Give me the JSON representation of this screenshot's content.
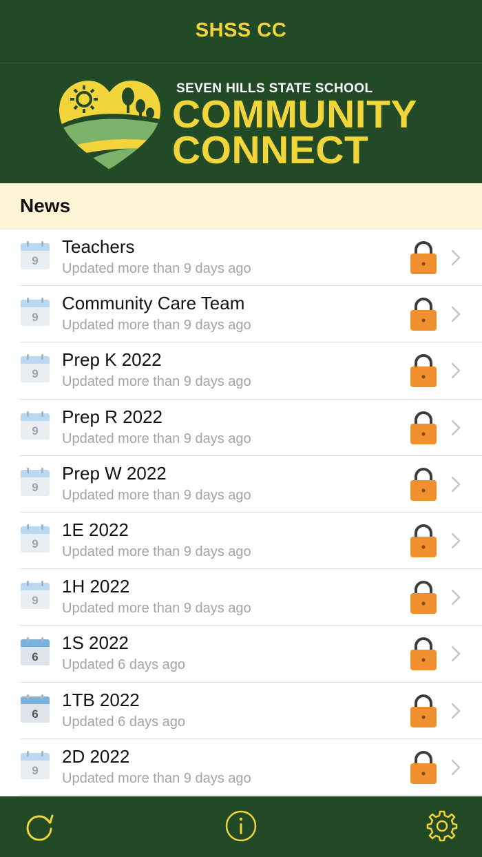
{
  "nav": {
    "title": "SHSS CC"
  },
  "banner": {
    "school_name": "SEVEN HILLS STATE SCHOOL",
    "brand_line1": "COMMUNITY",
    "brand_line2": "CONNECT"
  },
  "section": {
    "title": "News"
  },
  "items": [
    {
      "title": "Teachers",
      "subtitle": "Updated more than 9 days ago",
      "day": "9",
      "locked": true
    },
    {
      "title": "Community Care Team",
      "subtitle": "Updated more than 9 days ago",
      "day": "9",
      "locked": true
    },
    {
      "title": "Prep K 2022",
      "subtitle": "Updated more than 9 days ago",
      "day": "9",
      "locked": true
    },
    {
      "title": "Prep R 2022",
      "subtitle": "Updated more than 9 days ago",
      "day": "9",
      "locked": true
    },
    {
      "title": "Prep W 2022",
      "subtitle": "Updated more than 9 days ago",
      "day": "9",
      "locked": true
    },
    {
      "title": "1E 2022",
      "subtitle": "Updated more than 9 days ago",
      "day": "9",
      "locked": true
    },
    {
      "title": "1H 2022",
      "subtitle": "Updated more than 9 days ago",
      "day": "9",
      "locked": true
    },
    {
      "title": "1S 2022",
      "subtitle": "Updated 6 days ago",
      "day": "6",
      "locked": true
    },
    {
      "title": "1TB 2022",
      "subtitle": "Updated 6 days ago",
      "day": "6",
      "locked": true
    },
    {
      "title": "2D 2022",
      "subtitle": "Updated more than 9 days ago",
      "day": "9",
      "locked": true
    }
  ],
  "tabbar": {
    "icons": [
      "refresh-icon",
      "info-icon",
      "settings-gear-icon"
    ]
  },
  "colors": {
    "brand_green": "#234a26",
    "brand_yellow": "#f2d43b",
    "header_cream": "#fdf5d6",
    "lock_orange": "#f0902f",
    "subtitle_gray": "#a3a3a3"
  }
}
